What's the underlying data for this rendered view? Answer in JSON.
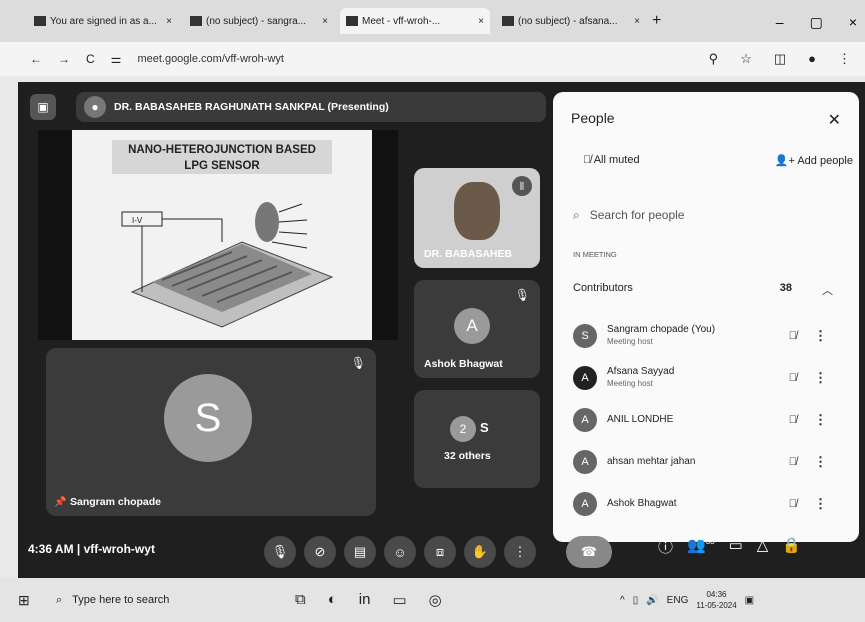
{
  "browser": {
    "tabs": [
      {
        "title": "You are signed in as a...",
        "close": "×"
      },
      {
        "title": "(no subject) - sangra...",
        "close": "×"
      },
      {
        "title": "Meet - vff-wroh-...",
        "close": "×"
      },
      {
        "title": "(no subject) - afsana...",
        "close": "×"
      }
    ],
    "new_tab": "+",
    "window_controls": [
      "–",
      "▢",
      "×"
    ],
    "url": "meet.google.com/vff-wroh-wyt"
  },
  "meet": {
    "presenter_label": "DR. BABASAHEB RAGHUNATH SANKPAL (Presenting)",
    "slide": {
      "title_line1": "NANO-HETEROJUNCTION BASED",
      "title_line2": "LPG SENSOR",
      "voltage_label": "I-V"
    },
    "tiles": {
      "presenter_cam_name": "DR. BABASAHEB",
      "ashok_name": "Ashok Bhagwat",
      "ashok_initial": "A",
      "others_label": "32 others",
      "others_initial": "S",
      "sangram_name": "Sangram chopade",
      "sangram_initial": "S"
    },
    "clock": "4:36 AM",
    "meeting_code": "vff-wroh-wyt",
    "more_label": "33"
  },
  "people": {
    "title": "People",
    "all_muted": "All muted",
    "add_people": "Add people",
    "search_placeholder": "Search for people",
    "section": "IN MEETING",
    "contributors_label": "Contributors",
    "contributors_count": "38",
    "rows": [
      {
        "initial": "S",
        "name": "Sangram chopade (You)",
        "sub": "Meeting host"
      },
      {
        "initial": "A",
        "name": "Afsana Sayyad",
        "sub": "Meeting host"
      },
      {
        "initial": "A",
        "name": "ANIL LONDHE",
        "sub": ""
      },
      {
        "initial": "A",
        "name": "ahsan mehtar jahan",
        "sub": ""
      },
      {
        "initial": "A",
        "name": "Ashok Bhagwat",
        "sub": ""
      }
    ]
  },
  "taskbar": {
    "search_placeholder": "Type here to search",
    "lang": "ENG",
    "time": "04:36",
    "date": "11-05-2024"
  }
}
